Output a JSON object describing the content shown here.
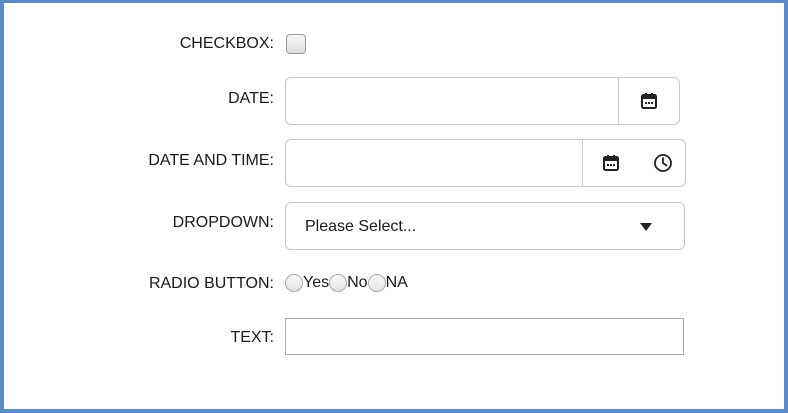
{
  "form": {
    "checkbox_label": "CHECKBOX:",
    "date_label": "DATE:",
    "datetime_label": "DATE AND TIME:",
    "dropdown_label": "DROPDOWN:",
    "dropdown_value": "Please Select...",
    "radio_label": "RADIO BUTTON:",
    "radio_options": [
      "Yes",
      "No",
      "NA"
    ],
    "text_label": "TEXT:",
    "text_value": "",
    "date_value": "",
    "datetime_value": "",
    "checkbox_checked": false
  },
  "icons": {
    "date_picker": "calendar-icon",
    "datetime_date_picker": "calendar-icon",
    "datetime_time_picker": "clock-icon",
    "dropdown_caret": "caret-down-icon"
  },
  "colors": {
    "frame_border": "#5b8ac6",
    "field_border": "#c8c8c8"
  }
}
